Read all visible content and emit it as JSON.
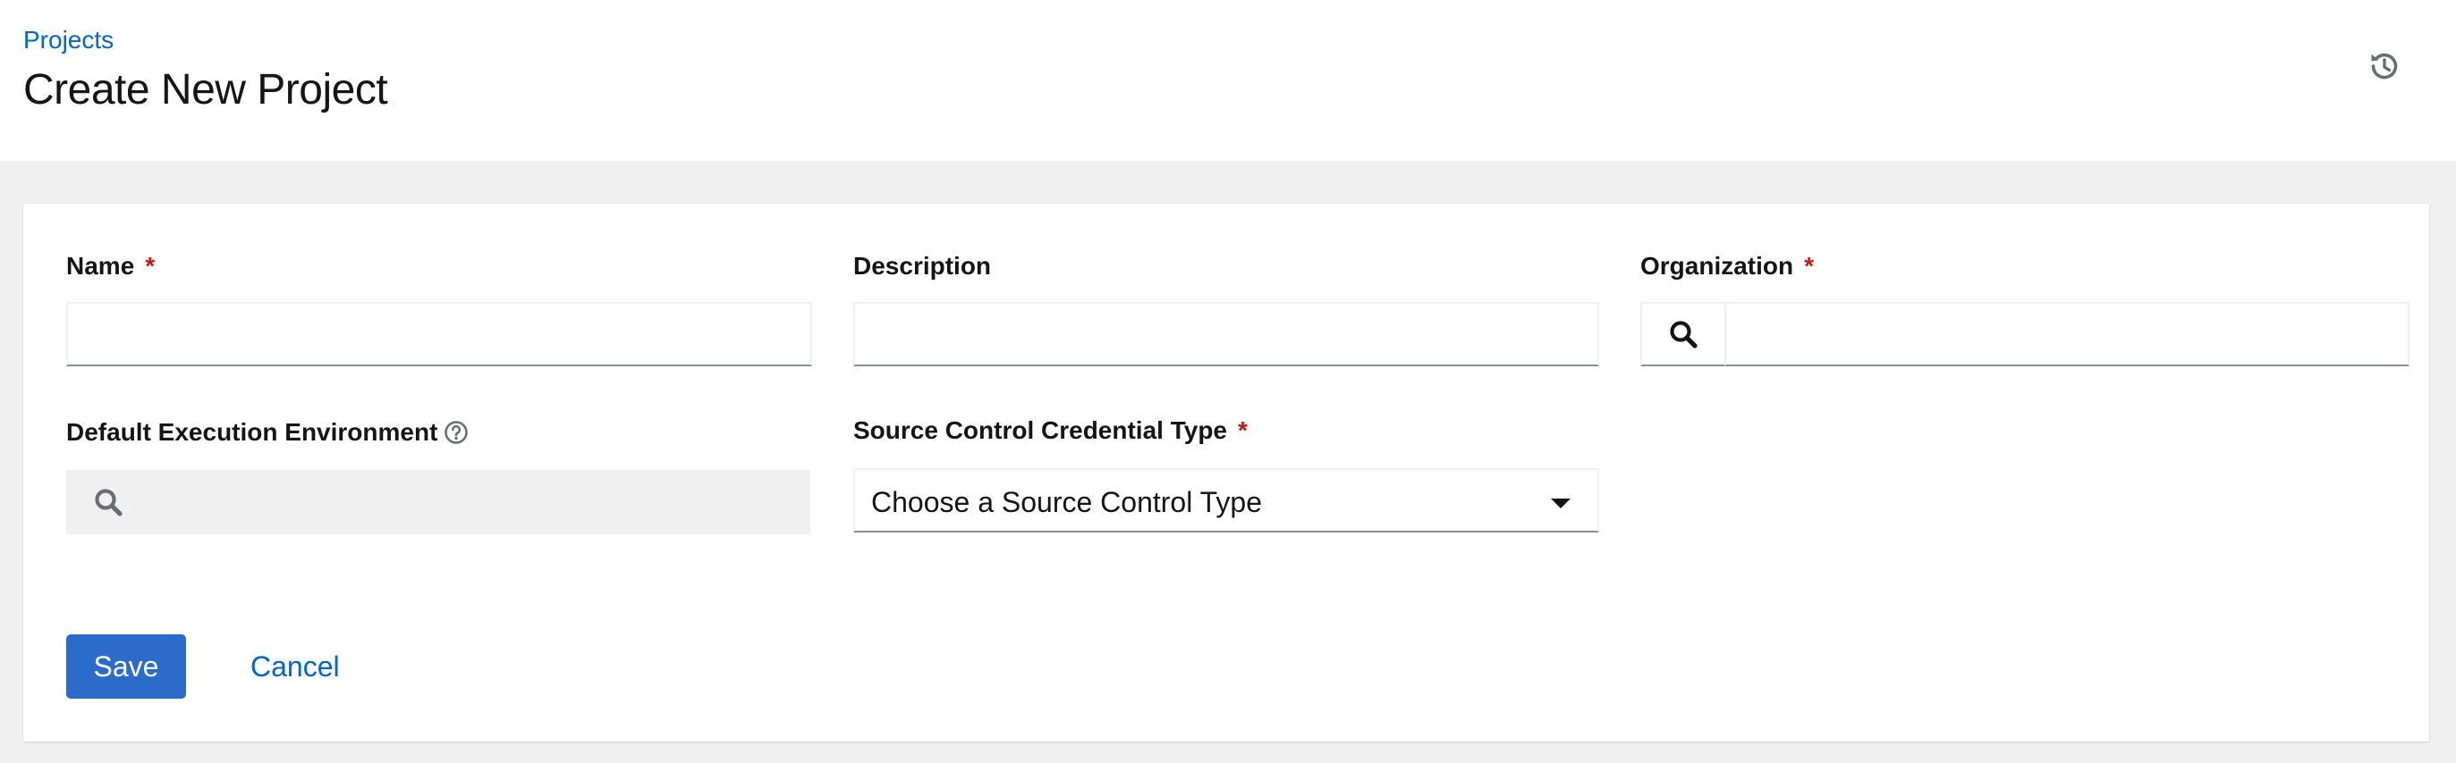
{
  "breadcrumb": {
    "label": "Projects"
  },
  "header": {
    "title": "Create New Project",
    "history_icon": "history-icon"
  },
  "form": {
    "name": {
      "label": "Name",
      "required_marker": "*",
      "value": ""
    },
    "description": {
      "label": "Description",
      "value": ""
    },
    "organization": {
      "label": "Organization",
      "required_marker": "*",
      "value": "",
      "icon": "search-icon"
    },
    "execution_environment": {
      "label": "Default Execution Environment",
      "help_icon": "question-circle-icon",
      "icon": "search-icon",
      "disabled": true
    },
    "source_control_type": {
      "label": "Source Control Credential Type",
      "required_marker": "*",
      "selected": "Choose a Source Control Type"
    }
  },
  "actions": {
    "save_label": "Save",
    "cancel_label": "Cancel"
  },
  "colors": {
    "primary": "#2b6ccb",
    "link": "#0066cc",
    "required": "#c9190b",
    "page_background": "#f0f0f0"
  }
}
